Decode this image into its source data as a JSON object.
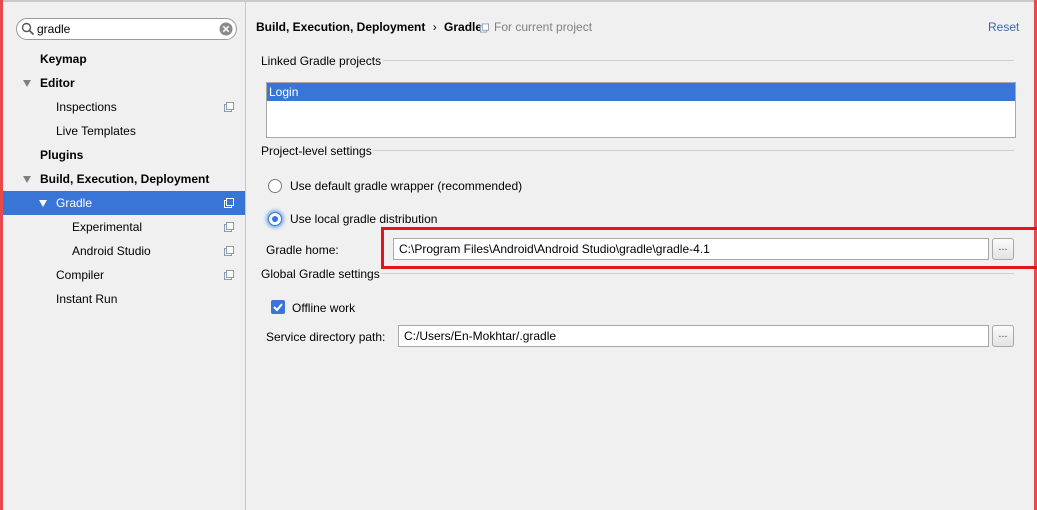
{
  "search": {
    "value": "gradle"
  },
  "sidebar": {
    "items": [
      {
        "label": "Keymap"
      },
      {
        "label": "Editor"
      },
      {
        "label": "Inspections"
      },
      {
        "label": "Live Templates"
      },
      {
        "label": "Plugins"
      },
      {
        "label": "Build, Execution, Deployment"
      },
      {
        "label": "Gradle"
      },
      {
        "label": "Experimental"
      },
      {
        "label": "Android Studio"
      },
      {
        "label": "Compiler"
      },
      {
        "label": "Instant Run"
      }
    ]
  },
  "header": {
    "breadcrumb_parent": "Build, Execution, Deployment",
    "breadcrumb_separator": "›",
    "breadcrumb_current": "Gradle",
    "scope_label": "For current project",
    "reset_label": "Reset"
  },
  "linked_projects": {
    "title": "Linked Gradle projects",
    "items": [
      "Login"
    ]
  },
  "project_settings": {
    "title": "Project-level settings",
    "option_wrapper": "Use default gradle wrapper (recommended)",
    "option_local": "Use local gradle distribution",
    "selected_option": "local",
    "gradle_home_label": "Gradle home:",
    "gradle_home_value": "C:\\Program Files\\Android\\Android Studio\\gradle\\gradle-4.1",
    "browse_label": "..."
  },
  "global_settings": {
    "title": "Global Gradle settings",
    "offline_work_label": "Offline work",
    "offline_work_checked": true,
    "service_dir_label": "Service directory path:",
    "service_dir_value": "C:/Users/En-Mokhtar/.gradle",
    "browse_label": "..."
  },
  "colors": {
    "selection": "#3875d7",
    "highlight_annotation": "#e5141b",
    "link": "#3a6aa6"
  },
  "icons": [
    "search-icon",
    "clear-search-icon",
    "tree-expand-arrow-icon",
    "project-scope-icon",
    "checkmark-icon"
  ]
}
